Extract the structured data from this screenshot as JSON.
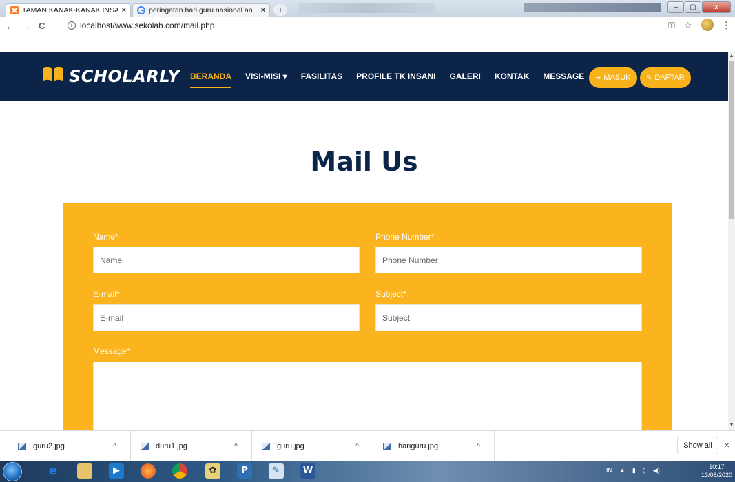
{
  "browser": {
    "tabs": [
      {
        "title": "TAMAN KANAK-KANAK INSANI",
        "favicon": "xampp-icon",
        "active": true
      },
      {
        "title": "peringatan hari guru nasional an",
        "favicon": "google-icon",
        "active": false
      }
    ],
    "new_tab_label": "+",
    "close_glyph": "×",
    "url": "localhost/www.sekolah.com/mail.php",
    "nav": {
      "back": "←",
      "forward": "→",
      "reload": "C"
    },
    "right_icons": {
      "key": "⚿",
      "star": "☆",
      "menu": "⋮"
    },
    "window_buttons": {
      "minimize": "–",
      "maximize": "▢",
      "close": "x"
    }
  },
  "site": {
    "brand": "SCHOLARLY",
    "menu": [
      {
        "label": "BERANDA",
        "active": true
      },
      {
        "label": "VISI-MISI ▾",
        "active": false
      },
      {
        "label": "FASILITAS",
        "active": false
      },
      {
        "label": "PROFILE TK INSANI",
        "active": false
      },
      {
        "label": "GALERI",
        "active": false
      },
      {
        "label": "KONTAK",
        "active": false
      },
      {
        "label": "MESSAGE",
        "active": false
      }
    ],
    "login_label": "MASUK",
    "register_label": "DAFTAR",
    "accent_color": "#f8b31c",
    "header_color": "#0b2447"
  },
  "content": {
    "title": "Mail Us",
    "form": {
      "name_label": "Name*",
      "name_placeholder": "Name",
      "phone_label": "Phone Number*",
      "phone_placeholder": "Phone Number",
      "email_label": "E-mail*",
      "email_placeholder": "E-mail",
      "subject_label": "Subject*",
      "subject_placeholder": "Subject",
      "message_label": "Message*"
    }
  },
  "downloads": {
    "items": [
      "guru2.jpg",
      "duru1.jpg",
      "guru.jpg",
      "hariguru.jpg"
    ],
    "chevron": "^",
    "show_all": "Show all",
    "close": "×"
  },
  "taskbar": {
    "language": "IN",
    "tray_arrow": "▲",
    "time": "10:17",
    "date": "13/08/2020"
  }
}
